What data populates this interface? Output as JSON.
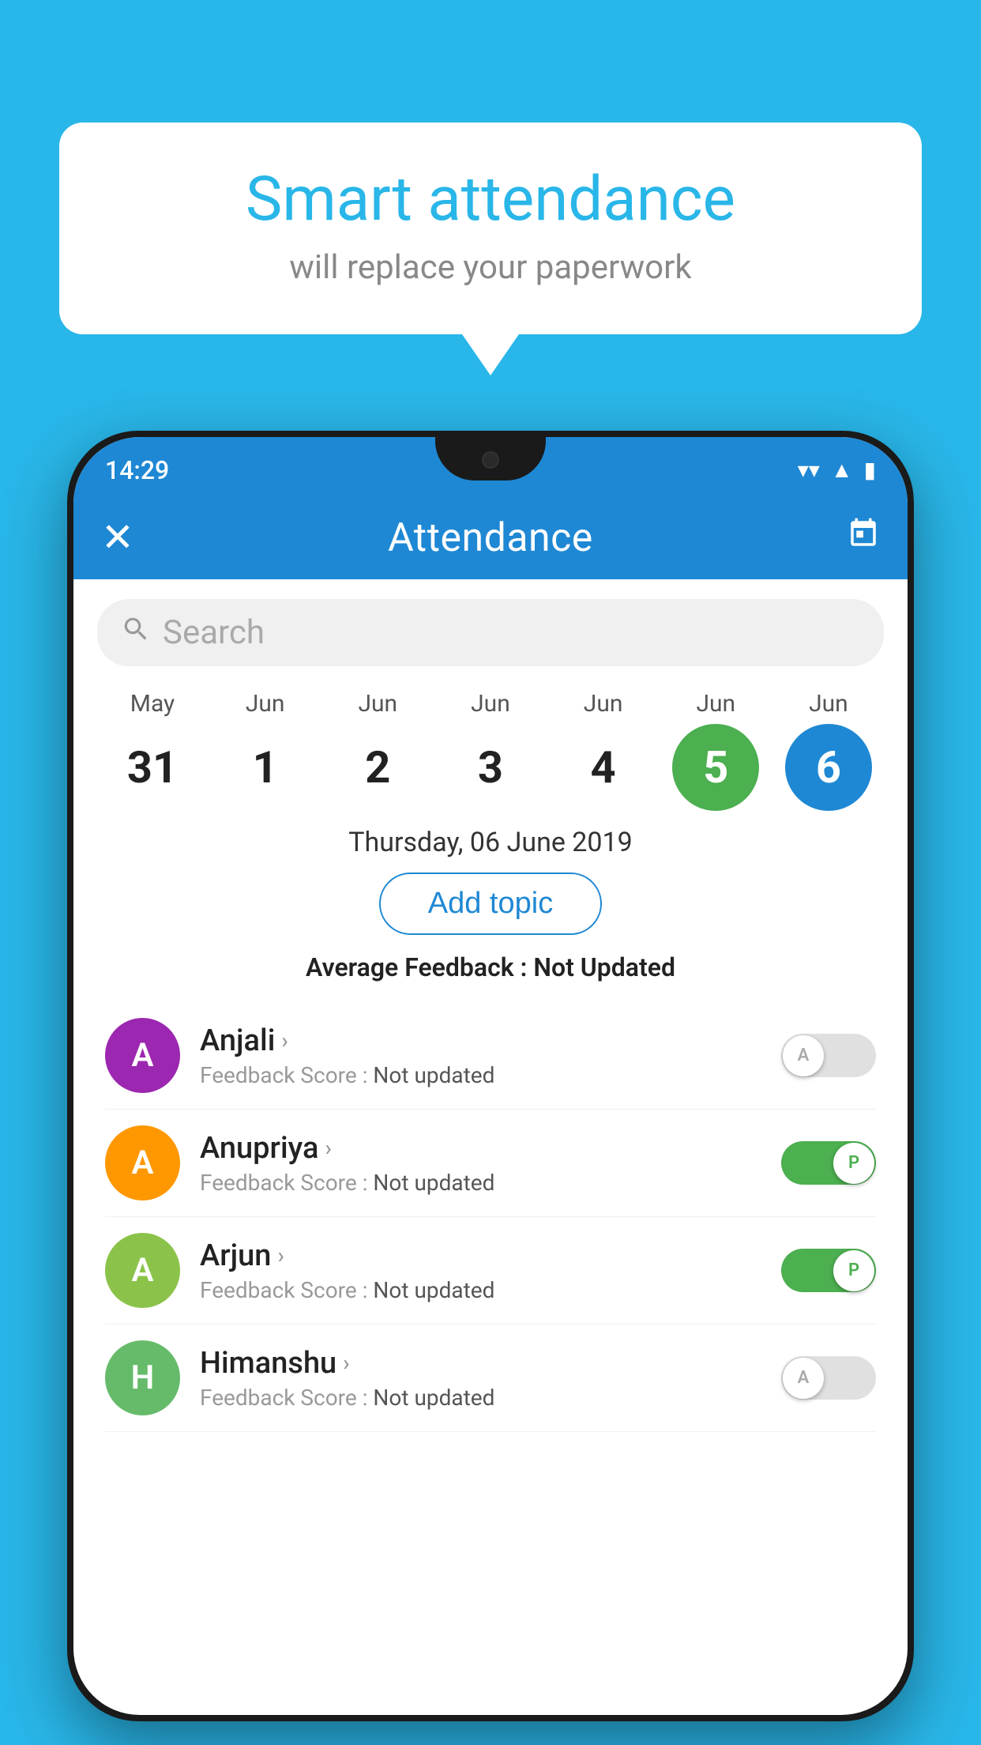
{
  "background_color": "#29b6e8",
  "bubble": {
    "title": "Smart attendance",
    "subtitle": "will replace your paperwork"
  },
  "status_bar": {
    "time": "14:29",
    "wifi_icon": "▾",
    "signal_icon": "▲",
    "battery_icon": "▮"
  },
  "app_bar": {
    "title": "Attendance",
    "close_label": "✕",
    "calendar_icon": "📅"
  },
  "search": {
    "placeholder": "Search"
  },
  "date_strip": [
    {
      "month": "May",
      "day": "31",
      "style": "normal"
    },
    {
      "month": "Jun",
      "day": "1",
      "style": "normal"
    },
    {
      "month": "Jun",
      "day": "2",
      "style": "normal"
    },
    {
      "month": "Jun",
      "day": "3",
      "style": "normal"
    },
    {
      "month": "Jun",
      "day": "4",
      "style": "normal"
    },
    {
      "month": "Jun",
      "day": "5",
      "style": "green"
    },
    {
      "month": "Jun",
      "day": "6",
      "style": "blue"
    }
  ],
  "selected_date": "Thursday, 06 June 2019",
  "add_topic_label": "Add topic",
  "average_feedback_label": "Average Feedback : ",
  "average_feedback_value": "Not Updated",
  "students": [
    {
      "name": "Anjali",
      "initial": "A",
      "avatar_color": "purple",
      "feedback": "Not updated",
      "toggle": "off",
      "toggle_label": "A"
    },
    {
      "name": "Anupriya",
      "initial": "A",
      "avatar_color": "orange",
      "feedback": "Not updated",
      "toggle": "on",
      "toggle_label": "P"
    },
    {
      "name": "Arjun",
      "initial": "A",
      "avatar_color": "green-light",
      "feedback": "Not updated",
      "toggle": "on",
      "toggle_label": "P"
    },
    {
      "name": "Himanshu",
      "initial": "H",
      "avatar_color": "green-medium",
      "feedback": "Not updated",
      "toggle": "off",
      "toggle_label": "A"
    }
  ],
  "feedback_score_label": "Feedback Score : "
}
